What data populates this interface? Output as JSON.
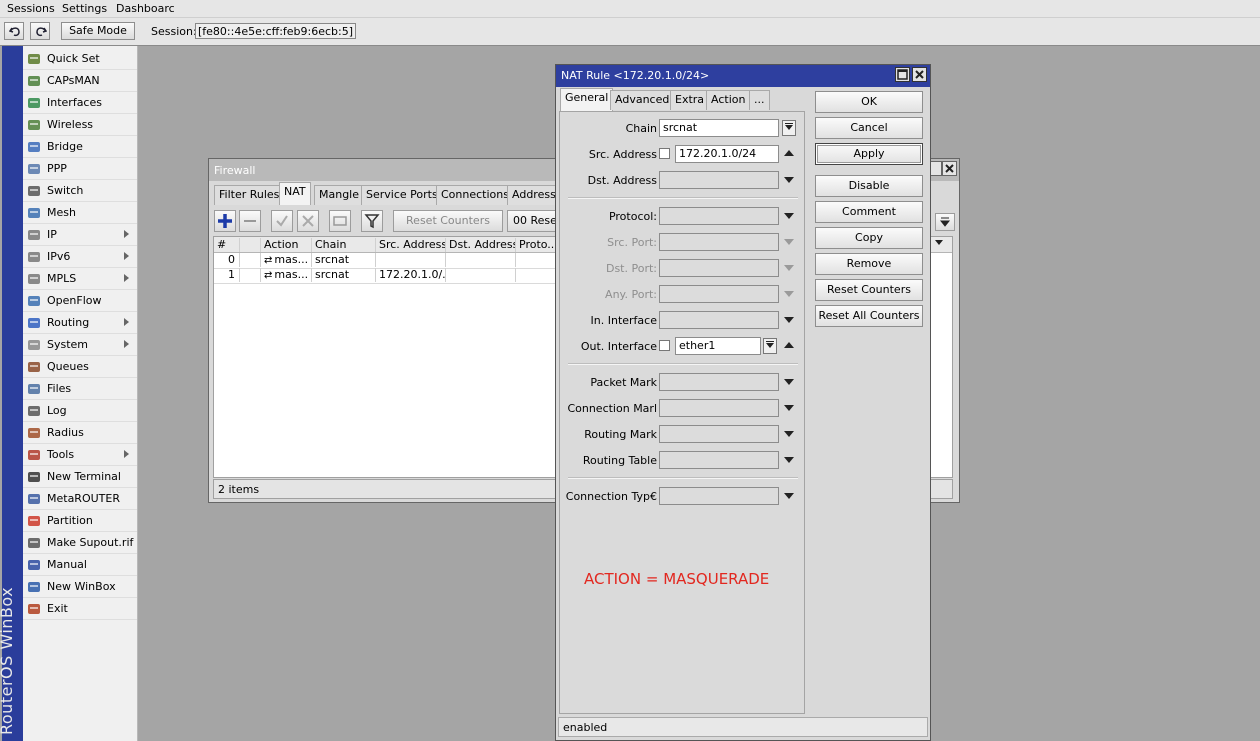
{
  "menu": {
    "sessions": "Sessions",
    "settings": "Settings",
    "dashboard": "Dashboarc"
  },
  "toolbar": {
    "safe_mode": "Safe Mode",
    "session_label": "Session:",
    "session_value": "[fe80::4e5e:cff:feb9:6ecb:5]"
  },
  "brand": {
    "text": "RouterOS WinBox",
    "bar_color": "#2a3d9b"
  },
  "sidebar": {
    "items": [
      {
        "label": "Quick Set",
        "icon": "quick-set-icon",
        "submenu": false
      },
      {
        "label": "CAPsMAN",
        "icon": "capsman-icon",
        "submenu": false
      },
      {
        "label": "Interfaces",
        "icon": "interfaces-icon",
        "submenu": false
      },
      {
        "label": "Wireless",
        "icon": "wireless-icon",
        "submenu": false
      },
      {
        "label": "Bridge",
        "icon": "bridge-icon",
        "submenu": false
      },
      {
        "label": "PPP",
        "icon": "ppp-icon",
        "submenu": false
      },
      {
        "label": "Switch",
        "icon": "switch-icon",
        "submenu": false
      },
      {
        "label": "Mesh",
        "icon": "mesh-icon",
        "submenu": false
      },
      {
        "label": "IP",
        "icon": "ip-icon",
        "submenu": true
      },
      {
        "label": "IPv6",
        "icon": "ipv6-icon",
        "submenu": true
      },
      {
        "label": "MPLS",
        "icon": "mpls-icon",
        "submenu": true
      },
      {
        "label": "OpenFlow",
        "icon": "openflow-icon",
        "submenu": false
      },
      {
        "label": "Routing",
        "icon": "routing-icon",
        "submenu": true
      },
      {
        "label": "System",
        "icon": "system-icon",
        "submenu": true
      },
      {
        "label": "Queues",
        "icon": "queues-icon",
        "submenu": false
      },
      {
        "label": "Files",
        "icon": "files-icon",
        "submenu": false
      },
      {
        "label": "Log",
        "icon": "log-icon",
        "submenu": false
      },
      {
        "label": "Radius",
        "icon": "radius-icon",
        "submenu": false
      },
      {
        "label": "Tools",
        "icon": "tools-icon",
        "submenu": true
      },
      {
        "label": "New Terminal",
        "icon": "terminal-icon",
        "submenu": false
      },
      {
        "label": "MetaROUTER",
        "icon": "metarouter-icon",
        "submenu": false
      },
      {
        "label": "Partition",
        "icon": "partition-icon",
        "submenu": false
      },
      {
        "label": "Make Supout.rif",
        "icon": "supout-icon",
        "submenu": false
      },
      {
        "label": "Manual",
        "icon": "manual-icon",
        "submenu": false
      },
      {
        "label": "New WinBox",
        "icon": "winbox-icon",
        "submenu": false
      },
      {
        "label": "Exit",
        "icon": "exit-icon",
        "submenu": false
      }
    ]
  },
  "firewall": {
    "title": "Firewall",
    "tabs": [
      "Filter Rules",
      "NAT",
      "Mangle",
      "Service Ports",
      "Connections",
      "Address"
    ],
    "selected_tab": "NAT",
    "reset_counters": "Reset Counters",
    "reset_all_partial": "00 Rese",
    "columns": [
      "#",
      "",
      "Action",
      "Chain",
      "Src. Address",
      "Dst. Address",
      "Proto..."
    ],
    "rows": [
      {
        "num": "0",
        "action": "mas...",
        "chain": "srcnat",
        "src": "",
        "dst": ""
      },
      {
        "num": "1",
        "action": "mas...",
        "chain": "srcnat",
        "src": "172.20.1.0/...",
        "dst": ""
      }
    ],
    "status": "2 items"
  },
  "nat_dialog": {
    "title": "NAT Rule <172.20.1.0/24>",
    "title_color": "#2e3f9f",
    "tabs": [
      "General",
      "Advanced",
      "Extra",
      "Action",
      "..."
    ],
    "selected_tab": "General",
    "fields": {
      "chain": {
        "label": "Chain",
        "value": "srcnat"
      },
      "src_address": {
        "label": "Src. Address",
        "value": "172.20.1.0/24"
      },
      "dst_address": {
        "label": "Dst. Address",
        "value": ""
      },
      "protocol": {
        "label": "Protocol:",
        "value": ""
      },
      "src_port": {
        "label": "Src. Port:",
        "value": ""
      },
      "dst_port": {
        "label": "Dst. Port:",
        "value": ""
      },
      "any_port": {
        "label": "Any. Port:",
        "value": ""
      },
      "in_interface": {
        "label": "In. Interface",
        "value": ""
      },
      "out_interface": {
        "label": "Out. Interface",
        "value": "ether1"
      },
      "packet_mark": {
        "label": "Packet Mark",
        "value": ""
      },
      "connection_mark": {
        "label": "Connection Marl",
        "value": ""
      },
      "routing_mark": {
        "label": "Routing Mark",
        "value": ""
      },
      "routing_table": {
        "label": "Routing Table",
        "value": ""
      },
      "connection_type": {
        "label": "Connection Typ€",
        "value": ""
      }
    },
    "annotation": "ACTION = MASQUERADE",
    "annotation_color": "#e2271f",
    "buttons": {
      "ok": "OK",
      "cancel": "Cancel",
      "apply": "Apply",
      "disable": "Disable",
      "comment": "Comment",
      "copy": "Copy",
      "remove": "Remove",
      "reset_counters": "Reset Counters",
      "reset_all_counters": "Reset All Counters"
    },
    "status": "enabled"
  }
}
